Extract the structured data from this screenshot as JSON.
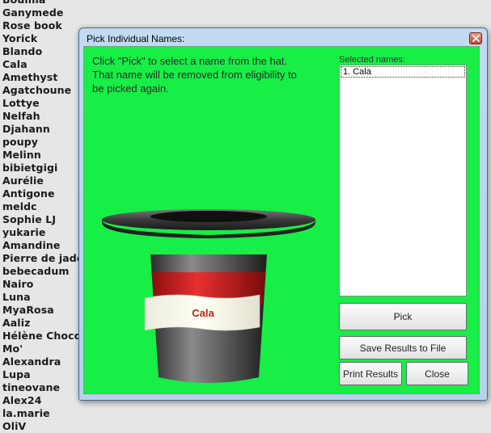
{
  "background_names": [
    "Boulma",
    "Ganymede",
    "Rose book",
    "Yorick",
    "Blando",
    "Cala",
    "Amethyst",
    "Agatchoune",
    "Lottye",
    "Nelfah",
    "Djahann",
    "poupy",
    "Melinn",
    "bibietgigi",
    "Aurélie",
    "Antigone",
    "meldc",
    "Sophie LJ",
    "yukarie",
    "Amandine",
    "Pierre de jade",
    "bebecadum",
    "Nairo",
    "Luna",
    "MyaRosa",
    "Aaliz",
    "Hélène Choco",
    "Mo'",
    "Alexandra",
    "Lupa",
    "tineovane",
    "Alex24",
    "la.marie",
    "OliV"
  ],
  "window": {
    "title": "Pick Individual Names:",
    "instructions": "Click \"Pick\" to select a name from the hat. That name will be removed from eligibility to be picked again.",
    "selected_label": "Selected names:",
    "selected_items": [
      "1. Cala"
    ],
    "hat_name": "Cala",
    "buttons": {
      "pick": "Pick",
      "save": "Save Results to File",
      "print": "Print Results",
      "close": "Close"
    }
  },
  "colors": {
    "client_background": "#17ee46",
    "hat_band": "#d42020",
    "hat_name_text": "#b8261c"
  }
}
